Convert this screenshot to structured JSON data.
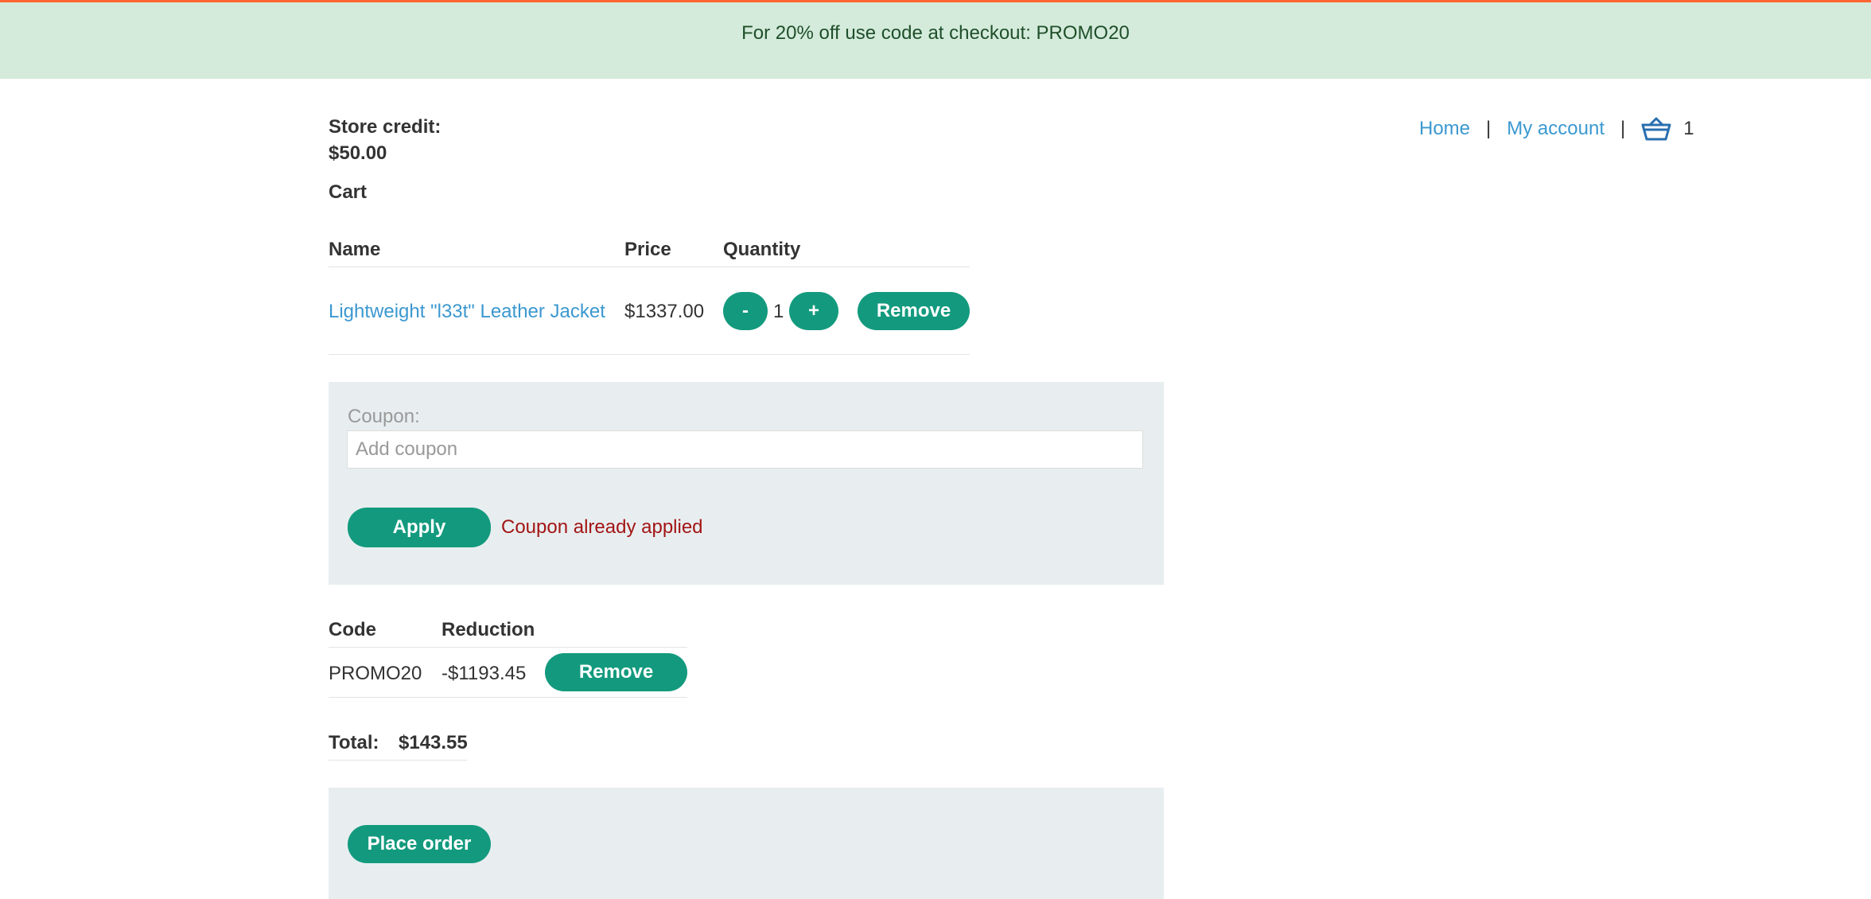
{
  "banner": {
    "text": "For 20% off use code at checkout: PROMO20"
  },
  "accent_color": "#139a7e",
  "link_color": "#3b98d0",
  "header_nav": {
    "home": "Home",
    "separator": "|",
    "my_account": "My account",
    "cart_icon": "basket-icon",
    "cart_count": "1"
  },
  "store_credit": {
    "label": "Store credit:",
    "value": "$50.00"
  },
  "cart": {
    "title": "Cart",
    "columns": [
      "Name",
      "Price",
      "Quantity"
    ],
    "items": [
      {
        "name": "Lightweight \"l33t\" Leather Jacket",
        "price": "$1337.00",
        "minus": "-",
        "quantity": "1",
        "plus": "+",
        "remove": "Remove"
      }
    ]
  },
  "coupon": {
    "label": "Coupon:",
    "placeholder": "Add coupon",
    "apply": "Apply",
    "message": "Coupon already applied"
  },
  "applied_coupons": {
    "columns": [
      "Code",
      "Reduction"
    ],
    "rows": [
      {
        "code": "PROMO20",
        "reduction": "-$1193.45",
        "remove": "Remove"
      }
    ]
  },
  "total": {
    "label": "Total:",
    "value": "$143.55"
  },
  "place_order": "Place order"
}
